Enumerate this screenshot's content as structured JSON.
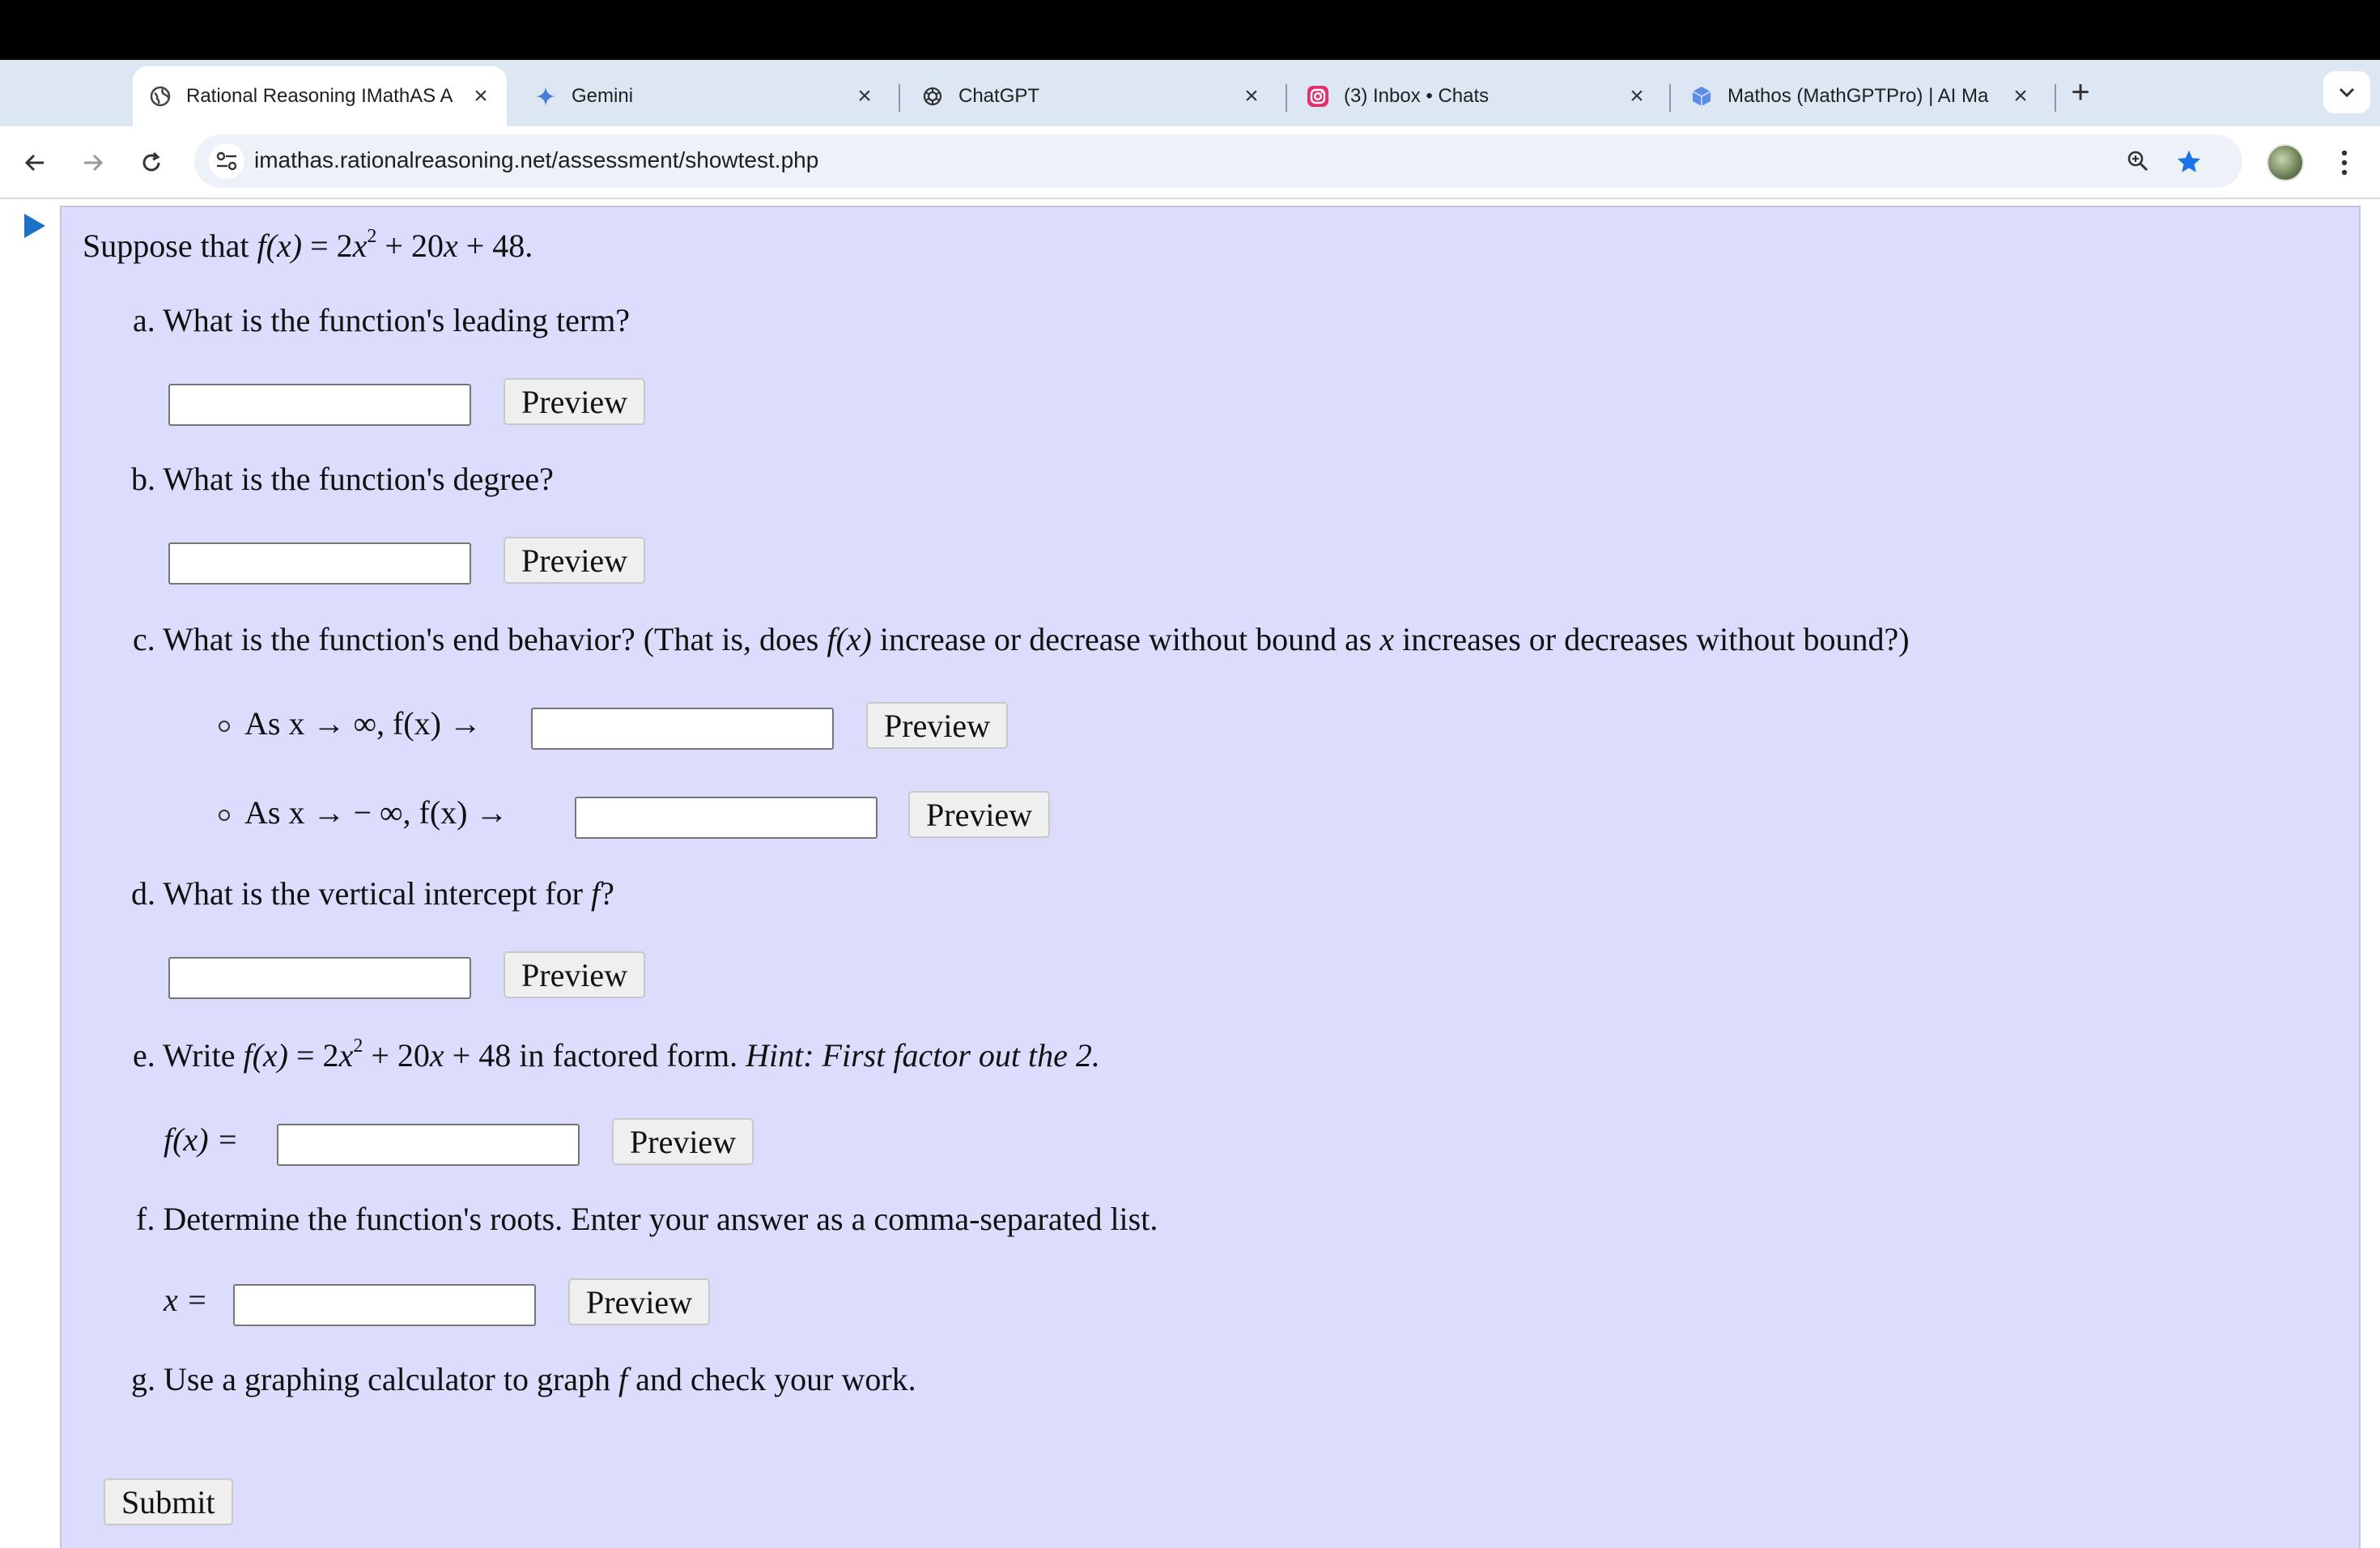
{
  "browser": {
    "tabs": [
      {
        "title": "Rational Reasoning IMathAS A",
        "icon": "globe-icon"
      },
      {
        "title": "Gemini",
        "icon": "gemini-sparkle-icon"
      },
      {
        "title": "ChatGPT",
        "icon": "chatgpt-icon"
      },
      {
        "title": "(3) Inbox • Chats",
        "icon": "instagram-icon"
      },
      {
        "title": "Mathos (MathGPTPro) | AI Ma",
        "icon": "mathos-cube-icon"
      }
    ],
    "url": "imathas.rationalreasoning.net/assessment/showtest.php",
    "colors": {
      "star": "#1a73e8",
      "tab_strip": "#dde7f4",
      "question_bg": "#dcdcfc"
    }
  },
  "problem": {
    "intro": {
      "prefix": "Suppose that ",
      "fx": "f(x)",
      "eq": " = 2",
      "x": "x",
      "sup": "2",
      "rest": " + 20",
      "x2": "x",
      "tail": " + 48."
    },
    "parts": {
      "a": {
        "label": "a. What is the function's leading term?"
      },
      "b": {
        "label": "b. What is the function's degree?"
      },
      "c": {
        "prefix": "c. What is the function's end behavior? (That is, does ",
        "fx": "f(x)",
        "mid": " increase or decrease without bound as ",
        "x": "x",
        "suffix": " increases or decreases without bound?)",
        "item1": "As x → ∞, f(x) →",
        "item2": "As x →  − ∞, f(x) →"
      },
      "d": {
        "prefix": "d. What is the vertical intercept for ",
        "f": "f",
        "suffix": "?"
      },
      "e": {
        "prefix": "e. Write ",
        "fx": "f(x)",
        "eq": " = 2",
        "x": "x",
        "sup": "2",
        "rest": " + 20",
        "x2": "x",
        "tail": " + 48 in factored form. ",
        "hint": "Hint: First factor out the 2.",
        "answer_label": "f(x) ="
      },
      "f": {
        "label": "f. Determine the function's roots. Enter your answer as a comma-separated list.",
        "answer_label": "x ="
      },
      "g": {
        "prefix": "g. Use a graphing calculator to graph ",
        "f": "f",
        "suffix": " and check your work."
      }
    },
    "preview_label": "Preview",
    "submit_label": "Submit"
  }
}
